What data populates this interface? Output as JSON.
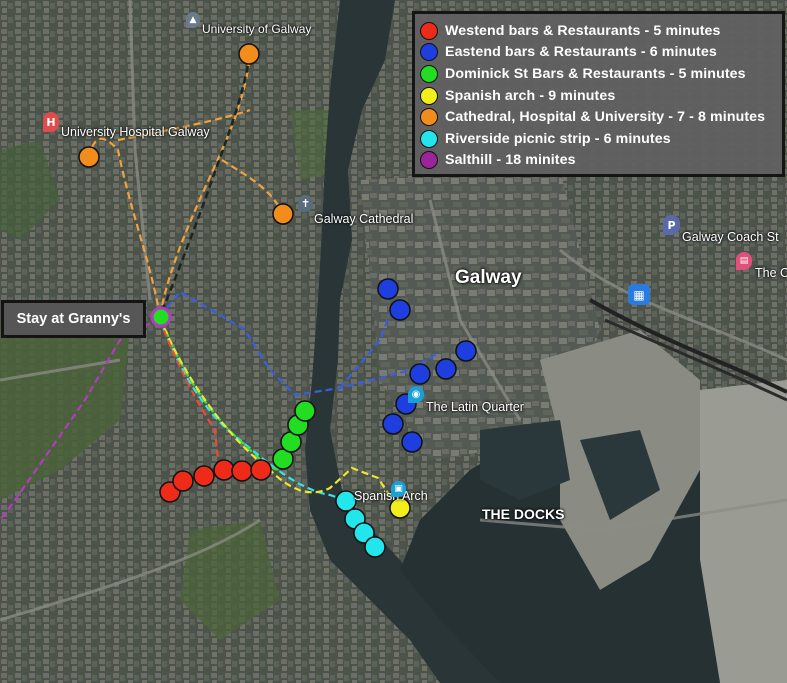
{
  "legend": {
    "items": [
      {
        "label": "Westend bars & Restaurants - 5 minutes",
        "color": "#ee2a18"
      },
      {
        "label": "Eastend bars & Restaurants - 6 minutes",
        "color": "#1f3ee0"
      },
      {
        "label": "Dominick St Bars & Restaurants - 5 minutes",
        "color": "#22dd22"
      },
      {
        "label": "Spanish arch - 9 minutes",
        "color": "#f2ee1c"
      },
      {
        "label": "Cathedral, Hospital & University - 7 - 8 minutes",
        "color": "#f28c1c"
      },
      {
        "label": "Riverside picnic strip - 6 minutes",
        "color": "#22e6ec"
      },
      {
        "label": "Salthill - 18 minites",
        "color": "#9a259a"
      }
    ]
  },
  "start_label": "Stay at Granny's",
  "places": {
    "university": "University of Galway",
    "hospital": "University Hospital Galway",
    "cathedral": "Galway Cathedral",
    "city": "Galway",
    "latin_quarter": "The Latin Quarter",
    "spanish_arch": "Spanish Arch",
    "docks": "THE DOCKS",
    "coach": "Galway Coach St",
    "edge_label": "The C"
  },
  "icons": {
    "hospital": "hospital-h-icon",
    "cathedral": "church-icon",
    "university": "school-icon",
    "latin_quarter": "camera-icon",
    "spanish_arch": "monument-icon",
    "coach": "parking-icon",
    "train": "train-icon",
    "edge": "cinema-icon"
  }
}
